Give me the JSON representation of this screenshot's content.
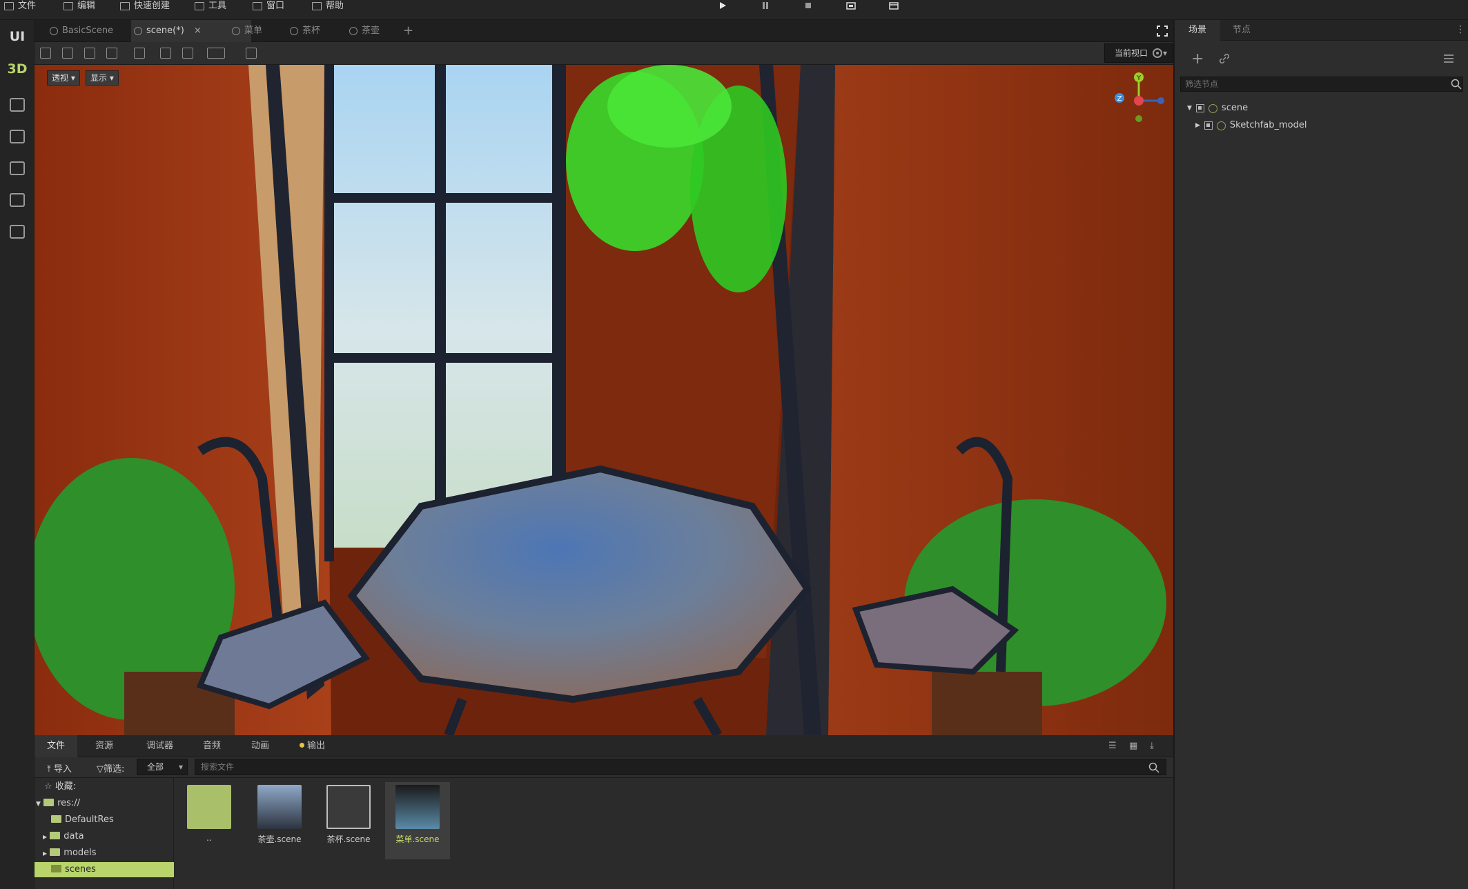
{
  "menubar": {
    "items": [
      {
        "label": "文件"
      },
      {
        "label": "编辑"
      },
      {
        "label": "快速创建"
      },
      {
        "label": "工具"
      },
      {
        "label": "窗口"
      },
      {
        "label": "帮助"
      }
    ],
    "controls": [
      "play-icon",
      "pause-icon",
      "stop-icon",
      "screenshot-icon",
      "capture-icon"
    ]
  },
  "leftbar": {
    "mode_ui": "UI",
    "mode_3d": "3D",
    "icons": [
      "path-icon",
      "store-icon",
      "settings-panel-icon",
      "export-icon",
      "document-icon"
    ]
  },
  "tabs": [
    {
      "label": "BasicScene",
      "active": false
    },
    {
      "label": "scene(*)",
      "active": true
    },
    {
      "label": "菜单",
      "active": false
    },
    {
      "label": "茶杯",
      "active": false
    },
    {
      "label": "茶壶",
      "active": false
    }
  ],
  "tab_close": "×",
  "tab_add": "+",
  "toolbar": {
    "view_select": "当前视口",
    "icons": [
      "select-icon",
      "move-icon",
      "rotate-icon",
      "scale-icon",
      "rect-icon",
      "pivot-icon",
      "snap-icon",
      "grid-icon",
      "camera-icon"
    ]
  },
  "viewport": {
    "projection": "透视",
    "display": "显示",
    "gizmo": {
      "y": "Y",
      "z": "Z"
    }
  },
  "right_panel": {
    "tabs": [
      {
        "label": "场景",
        "active": true
      },
      {
        "label": "节点",
        "active": false
      }
    ],
    "filter_placeholder": "筛选节点",
    "tree": [
      {
        "label": "scene",
        "level": 0,
        "expanded": true
      },
      {
        "label": "Sketchfab_model",
        "level": 1,
        "expanded": false
      }
    ]
  },
  "bottom": {
    "tabs": [
      {
        "label": "文件",
        "active": true
      },
      {
        "label": "资源",
        "active": false
      },
      {
        "label": "调试器",
        "active": false
      },
      {
        "label": "音频",
        "active": false
      },
      {
        "label": "动画",
        "active": false
      },
      {
        "label": "输出",
        "active": false,
        "dot": true
      }
    ],
    "import_label": "导入",
    "filter_label": "筛选:",
    "filter_value": "全部",
    "search_placeholder": "搜索文件",
    "tree": {
      "favorites": "收藏:",
      "root": "res://",
      "items": [
        {
          "label": "DefaultRes",
          "selected": false
        },
        {
          "label": "data",
          "selected": false
        },
        {
          "label": "models",
          "selected": false
        },
        {
          "label": "scenes",
          "selected": true
        }
      ]
    },
    "files": [
      {
        "label": "..",
        "type": "folder"
      },
      {
        "label": "茶壶.scene",
        "type": "teapot"
      },
      {
        "label": "茶杯.scene",
        "type": "scene"
      },
      {
        "label": "菜单.scene",
        "type": "menu",
        "selected": true
      }
    ]
  },
  "colors": {
    "accent": "#b8d46a",
    "axis_x": "#e0464a",
    "axis_y": "#9ccf2a",
    "axis_z": "#3a8fe0"
  }
}
